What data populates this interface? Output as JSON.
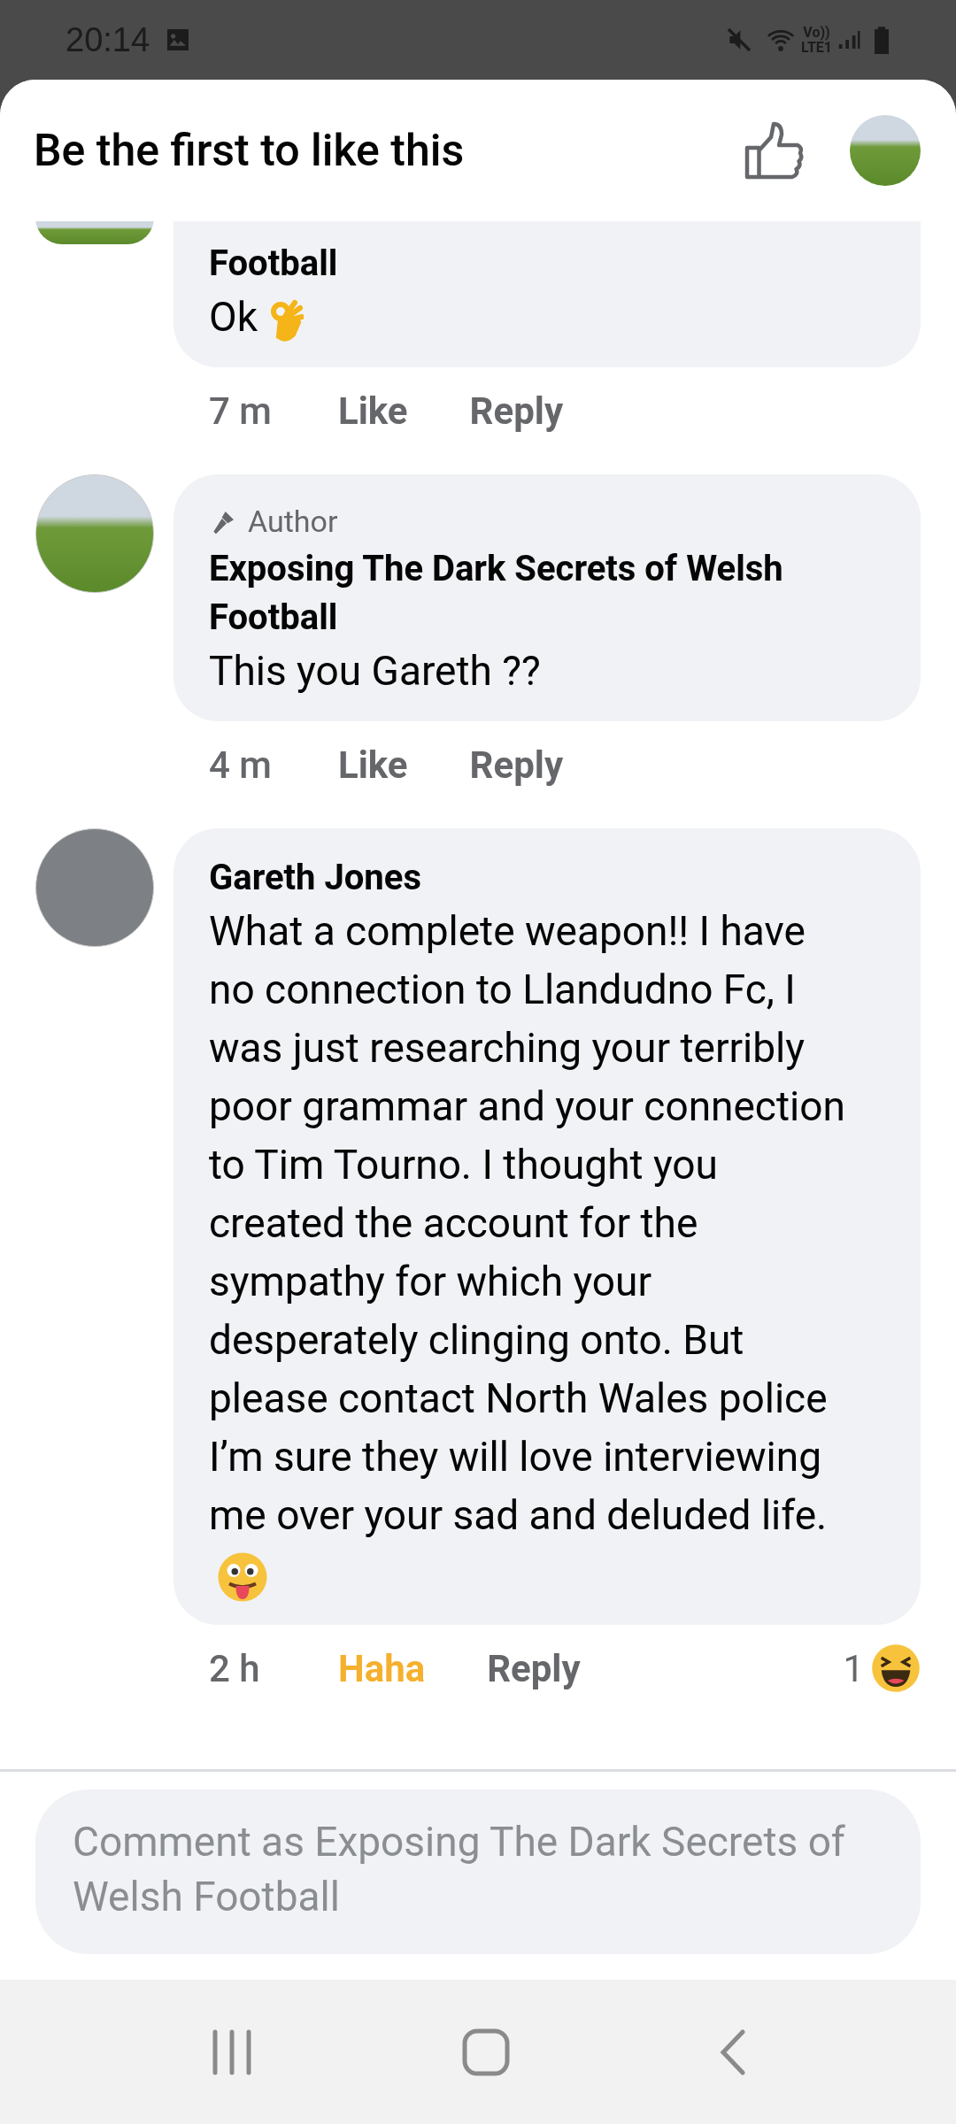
{
  "status_bar": {
    "time": "20:14",
    "network": "Vo))\nLTE1"
  },
  "header": {
    "title": "Be the first to like this"
  },
  "comments": [
    {
      "kind": "clipped",
      "name": "Football",
      "text": "Ok",
      "time": "7 m",
      "reaction_button": {
        "label": "Like",
        "reacted": false
      },
      "reply": "Reply"
    },
    {
      "kind": "full",
      "author_badge": "Author",
      "name": "Exposing The Dark Secrets of Welsh Football",
      "text": "This you Gareth ??",
      "time": "4 m",
      "reaction_button": {
        "label": "Like",
        "reacted": false
      },
      "reply": "Reply"
    },
    {
      "kind": "full",
      "name": "Gareth Jones",
      "text": "What a complete weapon!!  I have no connection to Llandudno Fc, I was just researching your terribly poor grammar and your connection to Tim Tourno. I thought you created the account for the sympathy for which your desperately clinging onto. But please contact North Wales police I’m sure they will love interviewing me over your sad and deluded life.",
      "time": "2 h",
      "reaction_button": {
        "label": "Haha",
        "reacted": true
      },
      "reply": "Reply",
      "reaction_count": "1"
    }
  ],
  "composer": {
    "placeholder": "Comment as Exposing The Dark Secrets of Welsh Football"
  }
}
